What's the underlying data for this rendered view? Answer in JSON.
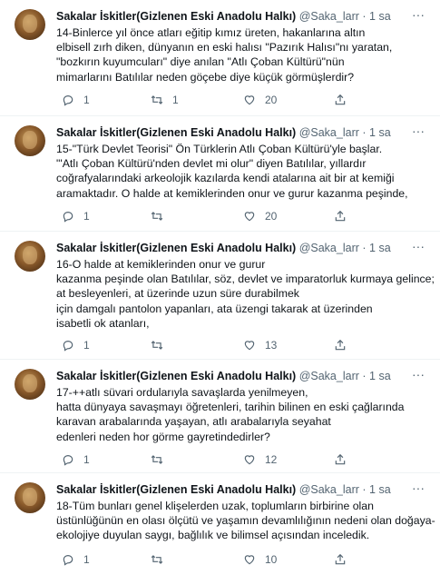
{
  "tweets": [
    {
      "name": "Sakalar İskitler(Gizlenen Eski Anadolu Halkı)",
      "handle": "@Saka_larr",
      "time": "1 sa",
      "lines": [
        "14-Binlerce yıl önce atları eğitip kımız üreten, hakanlarına altın",
        "elbisell zırh diken, dünyanın en eski halısı \"Pazırık Halısı\"nı yaratan,",
        "\"bozkırın kuyumcuları\" diye anılan \"Atlı Çoban Kültürü\"nün",
        "mimarlarını Batılılar neden göçebe diye küçük görmüşlerdir?"
      ],
      "reply_count": "1",
      "retweet_count": "1",
      "like_count": "20"
    },
    {
      "name": "Sakalar İskitler(Gizlenen Eski Anadolu Halkı)",
      "handle": "@Saka_larr",
      "time": "1 sa",
      "lines": [
        "15-\"Türk Devlet Teorisi\" Ön Türklerin Atlı Çoban Kültürü'yle başlar.",
        "\"'Atlı Çoban Kültürü'nden devlet mi olur\" diyen Batılılar, yıllardır",
        "coğrafyalarındaki arkeolojik kazılarda kendi atalarına ait bir at kemiği",
        "aramaktadır. O halde at kemiklerinden onur ve gurur kazanma peşinde,"
      ],
      "reply_count": "1",
      "retweet_count": "",
      "like_count": "20"
    },
    {
      "name": "Sakalar İskitler(Gizlenen Eski Anadolu Halkı)",
      "handle": "@Saka_larr",
      "time": "1 sa",
      "lines": [
        "16-O halde at kemiklerinden onur ve gurur",
        "kazanma peşinde olan Batılılar, söz, devlet ve imparatorluk kurmaya gelince;",
        "at besleyenleri, at üzerinde uzun süre durabilmek",
        "için damgalı pantolon yapanları, ata üzengi takarak at üzerinden",
        "isabetli ok atanları,"
      ],
      "reply_count": "1",
      "retweet_count": "",
      "like_count": "13"
    },
    {
      "name": "Sakalar İskitler(Gizlenen Eski Anadolu Halkı)",
      "handle": "@Saka_larr",
      "time": "1 sa",
      "lines": [
        "17-++atlı süvari ordularıyla savaşlarda yenilmeyen,",
        "hatta dünyaya savaşmayı öğretenleri, tarihin bilinen en eski çağlarında",
        "karavan arabalarında yaşayan, atlı arabalarıyla seyahat",
        "edenleri neden hor görme gayretindedirler?"
      ],
      "reply_count": "1",
      "retweet_count": "",
      "like_count": "12"
    },
    {
      "name": "Sakalar İskitler(Gizlenen Eski Anadolu Halkı)",
      "handle": "@Saka_larr",
      "time": "1 sa",
      "lines": [
        "18-Tüm bunları genel klişelerden uzak, toplumların birbirine olan",
        "üstünlüğünün en olası ölçütü ve yaşamın devamlılığının nedeni olan doğaya-",
        "ekolojiye duyulan saygı, bağlılık ve bilimsel açısından inceledik."
      ],
      "reply_count": "1",
      "retweet_count": "",
      "like_count": "10"
    }
  ],
  "icons": {
    "more": "more-horizontal-icon",
    "reply": "reply-icon",
    "retweet": "retweet-icon",
    "like": "heart-icon",
    "share": "share-icon"
  }
}
